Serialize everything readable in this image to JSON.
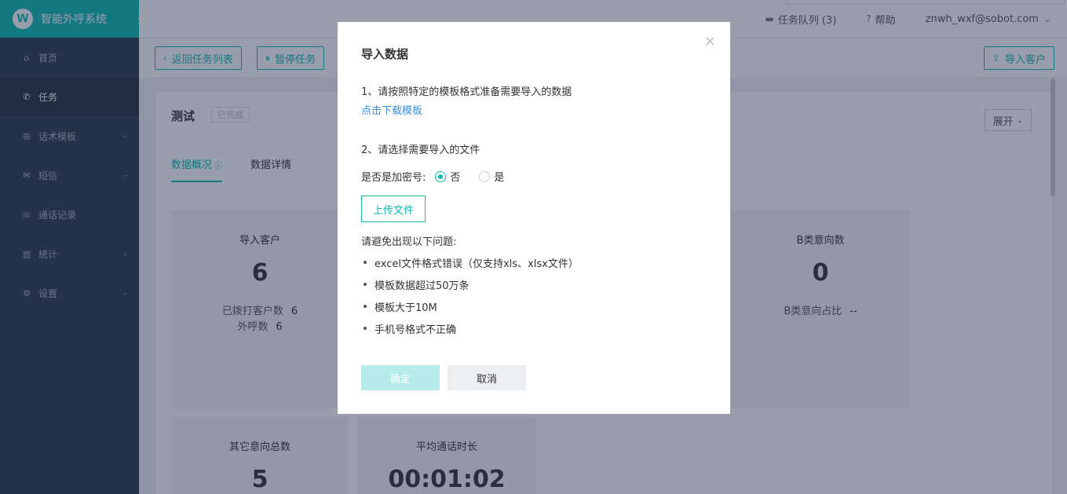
{
  "app": {
    "title": "智能外呼系统",
    "logo_glyph": "W"
  },
  "sidebar": {
    "items": [
      {
        "label": "首页",
        "icon": "home-icon",
        "glyph": "⌂"
      },
      {
        "label": "任务",
        "icon": "phone-icon",
        "glyph": "✆"
      },
      {
        "label": "话术模板",
        "icon": "sitemap-icon",
        "glyph": "⊞"
      },
      {
        "label": "短信",
        "icon": "mail-icon",
        "glyph": "✉"
      },
      {
        "label": "通话记录",
        "icon": "call-log-icon",
        "glyph": "☏"
      },
      {
        "label": "统计",
        "icon": "bar-chart-icon",
        "glyph": "▥"
      },
      {
        "label": "设置",
        "icon": "gear-icon",
        "glyph": "⚙"
      }
    ],
    "active_index": 1
  },
  "topbar": {
    "queue": "任务队列 (3)",
    "help": "帮助",
    "user": "znwh_wxf@sobot.com"
  },
  "toolbar": {
    "back": "返回任务列表",
    "pause": "暂停任务",
    "import_customer": "导入客户"
  },
  "task": {
    "name": "测试",
    "status": "已完成",
    "expand": "展开",
    "tabs": [
      "数据概况",
      "数据详情"
    ]
  },
  "cards": {
    "import": {
      "title": "导入客户",
      "value": "6",
      "sub1_label": "已拨打客户数",
      "sub1_value": "6",
      "sub2_label": "外呼数",
      "sub2_value": "6"
    },
    "b_intent": {
      "title": "B类意向数",
      "value": "0",
      "sub1_label": "B类意向占比",
      "sub1_value": "--"
    },
    "other_intent": {
      "title": "其它意向总数",
      "value": "5"
    },
    "avg_duration": {
      "title": "平均通话时长",
      "value": "00:01:02"
    }
  },
  "modal": {
    "title": "导入数据",
    "step1": "1、请按照特定的模板格式准备需要导入的数据",
    "download_link": "点击下载模板",
    "step2": "2、请选择需要导入的文件",
    "encrypt_label": "是否是加密号:",
    "option_no": "否",
    "option_yes": "是",
    "selected": "否",
    "upload": "上传文件",
    "issues_title": "请避免出现以下问题:",
    "issues": [
      "excel文件格式错误（仅支持xls、xlsx文件）",
      "模板数据超过50万条",
      "模板大于10M",
      "手机号格式不正确"
    ],
    "confirm": "确定",
    "cancel": "取消",
    "close": "×"
  },
  "colors": {
    "accent": "#0fb8b0",
    "sidebar": "#2f3b4c",
    "link": "#3a8ee6"
  }
}
